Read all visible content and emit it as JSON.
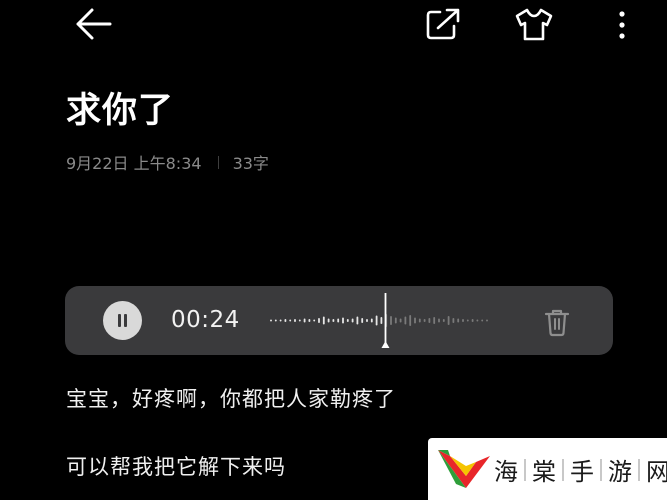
{
  "toolbar": {
    "back_icon": "arrow-left-icon",
    "share_icon": "share-export-icon",
    "theme_icon": "tshirt-icon",
    "more_icon": "more-vertical-icon"
  },
  "note": {
    "title": "求你了",
    "date": "9月22日 上午8:34",
    "word_count": "33字",
    "lines": [
      "宝宝，好疼啊，你都把人家勒疼了",
      "可以帮我把它解下来吗"
    ]
  },
  "audio": {
    "time": "00:24",
    "pause_icon": "pause-icon",
    "delete_icon": "trash-icon",
    "playback_progress": 0.53
  },
  "watermark": {
    "text": "海棠手游网",
    "chars": [
      "海",
      "棠",
      "手",
      "游",
      "网"
    ],
    "logo_colors": [
      "#2e9e3a",
      "#e8262a",
      "#f5c400"
    ]
  },
  "colors": {
    "background": "#000000",
    "player_bg": "#3a3a3c",
    "meta_text": "#8a8a8a"
  }
}
